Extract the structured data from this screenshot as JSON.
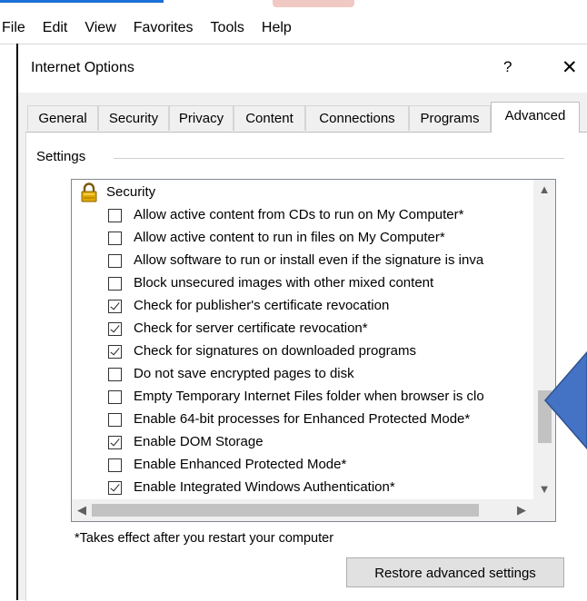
{
  "menubar": {
    "items": [
      "File",
      "Edit",
      "View",
      "Favorites",
      "Tools",
      "Help"
    ]
  },
  "dialog": {
    "title": "Internet Options",
    "help_glyph": "?",
    "close_glyph": "✕"
  },
  "tabs": [
    {
      "label": "General",
      "active": false
    },
    {
      "label": "Security",
      "active": false
    },
    {
      "label": "Privacy",
      "active": false
    },
    {
      "label": "Content",
      "active": false
    },
    {
      "label": "Connections",
      "active": false
    },
    {
      "label": "Programs",
      "active": false
    },
    {
      "label": "Advanced",
      "active": true
    }
  ],
  "settings": {
    "group_label": "Settings",
    "section_header": "Security",
    "section_icon": "lock-icon",
    "items": [
      {
        "label": "Allow active content from CDs to run on My Computer*",
        "checked": false
      },
      {
        "label": "Allow active content to run in files on My Computer*",
        "checked": false
      },
      {
        "label": "Allow software to run or install even if the signature is inva",
        "checked": false
      },
      {
        "label": "Block unsecured images with other mixed content",
        "checked": false
      },
      {
        "label": "Check for publisher's certificate revocation",
        "checked": true
      },
      {
        "label": "Check for server certificate revocation*",
        "checked": true
      },
      {
        "label": "Check for signatures on downloaded programs",
        "checked": true
      },
      {
        "label": "Do not save encrypted pages to disk",
        "checked": false
      },
      {
        "label": "Empty Temporary Internet Files folder when browser is clo",
        "checked": false
      },
      {
        "label": "Enable 64-bit processes for Enhanced Protected Mode*",
        "checked": false
      },
      {
        "label": "Enable DOM Storage",
        "checked": true
      },
      {
        "label": "Enable Enhanced Protected Mode*",
        "checked": false
      },
      {
        "label": "Enable Integrated Windows Authentication*",
        "checked": true
      }
    ]
  },
  "footnote": "*Takes effect after you restart your computer",
  "buttons": {
    "restore": "Restore advanced settings"
  },
  "scroll": {
    "up_glyph": "▲",
    "down_glyph": "▼",
    "left_glyph": "◀",
    "right_glyph": "▶"
  },
  "colors": {
    "arrow_fill": "#4472c4",
    "dialog_bg": "#f0f0f0"
  }
}
